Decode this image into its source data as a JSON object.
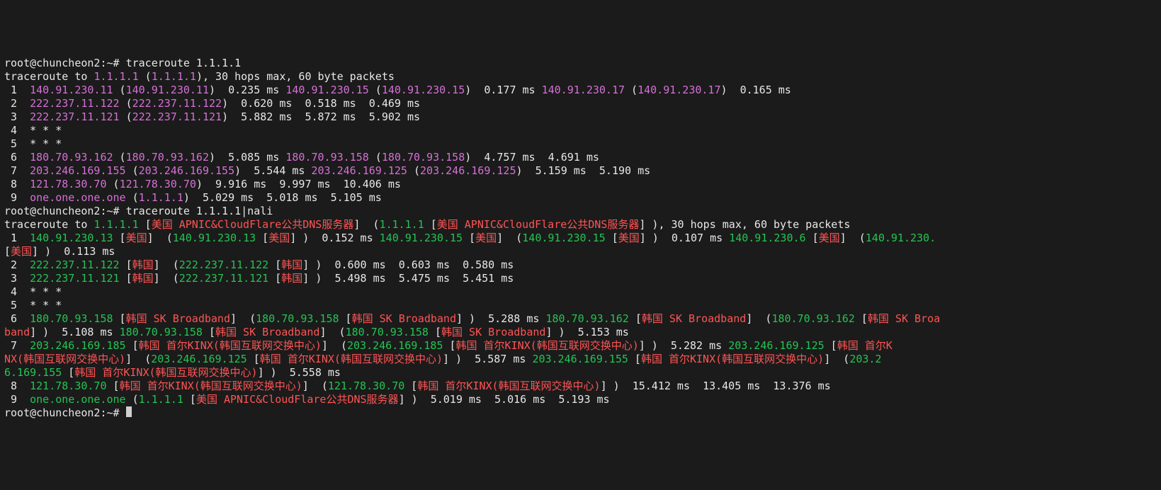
{
  "prompt": {
    "user": "root",
    "host": "chuncheon2",
    "cwd": "~",
    "hash": "#"
  },
  "cmd1": "traceroute 1.1.1.1",
  "cmd2": "traceroute 1.1.1.1|nali",
  "tr1_header": {
    "prefix": "traceroute to ",
    "target": "1.1.1.1",
    "target_ip": "1.1.1.1",
    "suffix": ", 30 hops max, 60 byte packets"
  },
  "tr1": {
    "hop1": {
      "n": " 1",
      "h1": "140.91.230.11",
      "p1": "140.91.230.11",
      "t1": "0.235 ms",
      "h2": "140.91.230.15",
      "p2": "140.91.230.15",
      "t2": "0.177 ms",
      "h3": "140.91.230.17",
      "p3": "140.91.230.17",
      "t3": "0.165 ms"
    },
    "hop2": {
      "n": " 2",
      "h1": "222.237.11.122",
      "p1": "222.237.11.122",
      "t1": "0.620 ms",
      "t2": "0.518 ms",
      "t3": "0.469 ms"
    },
    "hop3": {
      "n": " 3",
      "h1": "222.237.11.121",
      "p1": "222.237.11.121",
      "t1": "5.882 ms",
      "t2": "5.872 ms",
      "t3": "5.902 ms"
    },
    "hop4": {
      "n": " 4",
      "stars": "* * *"
    },
    "hop5": {
      "n": " 5",
      "stars": "* * *"
    },
    "hop6": {
      "n": " 6",
      "h1": "180.70.93.162",
      "p1": "180.70.93.162",
      "t1": "5.085 ms",
      "h2": "180.70.93.158",
      "p2": "180.70.93.158",
      "t2": "4.757 ms",
      "t3": "4.691 ms"
    },
    "hop7": {
      "n": " 7",
      "h1": "203.246.169.155",
      "p1": "203.246.169.155",
      "t1": "5.544 ms",
      "h2": "203.246.169.125",
      "p2": "203.246.169.125",
      "t2": "5.159 ms",
      "t3": "5.190 ms"
    },
    "hop8": {
      "n": " 8",
      "h1": "121.78.30.70",
      "p1": "121.78.30.70",
      "t1": "9.916 ms",
      "t2": "9.997 ms",
      "t3": "10.406 ms"
    },
    "hop9": {
      "n": " 9",
      "h1": "one.one.one.one",
      "p1": "1.1.1.1",
      "t1": "5.029 ms",
      "t2": "5.018 ms",
      "t3": "5.105 ms"
    }
  },
  "tr2_header": {
    "prefix": "traceroute to ",
    "target": "1.1.1.1",
    "tag": "美国 APNIC&CloudFlare公共DNS服务器",
    "suffix": ", 30 hops max, 60 byte packets"
  },
  "tr2": {
    "hop1": {
      "n": " 1",
      "h1": "140.91.230.13",
      "tag": "美国",
      "t1": "0.152 ms",
      "h2": "140.91.230.15",
      "t2": "0.107 ms",
      "h3": "140.91.230.6",
      "wrap_tail": "140.91.230.",
      "tag3": "美国",
      "t3": "0.113 ms"
    },
    "hop2": {
      "n": " 2",
      "h1": "222.237.11.122",
      "tag": "韩国",
      "t1": "0.600 ms",
      "t2": "0.603 ms",
      "t3": "0.580 ms"
    },
    "hop3": {
      "n": " 3",
      "h1": "222.237.11.121",
      "tag": "韩国",
      "t1": "5.498 ms",
      "t2": "5.475 ms",
      "t3": "5.451 ms"
    },
    "hop4": {
      "n": " 4",
      "stars": "* * *"
    },
    "hop5": {
      "n": " 5",
      "stars": "* * *"
    },
    "hop6": {
      "n": " 6",
      "h1": "180.70.93.158",
      "tag": "韩国 SK Broadband",
      "t1": "5.288 ms",
      "h2": "180.70.93.162",
      "t2": "5.108 ms",
      "h3": "180.70.93.158",
      "t3": "5.153 ms",
      "wrap_tail": "韩国 SK Broa",
      "wrap_head": "band"
    },
    "hop7": {
      "n": " 7",
      "h1": "203.246.169.185",
      "tag": "韩国 首尔KINX(韩国互联网交换中心)",
      "t1": "5.282 ms",
      "h2": "203.246.169.125",
      "t2": "5.587 ms",
      "h3": "203.246.169.155",
      "t3": "5.558 ms",
      "wrap_tail1": "韩国 首尔K",
      "wrap_head1": "NX(韩国互联网交换中心)",
      "wrap_tail2": "203.2",
      "wrap_head2": "6.169.155"
    },
    "hop8": {
      "n": " 8",
      "h1": "121.78.30.70",
      "tag": "韩国 首尔KINX(韩国互联网交换中心)",
      "t1": "15.412 ms",
      "t2": "13.405 ms",
      "t3": "13.376 ms"
    },
    "hop9": {
      "n": " 9",
      "h1": "one.one.one.one",
      "p1": "1.1.1.1",
      "tag": "美国 APNIC&CloudFlare公共DNS服务器",
      "t1": "5.019 ms",
      "t2": "5.016 ms",
      "t3": "5.193 ms"
    }
  }
}
